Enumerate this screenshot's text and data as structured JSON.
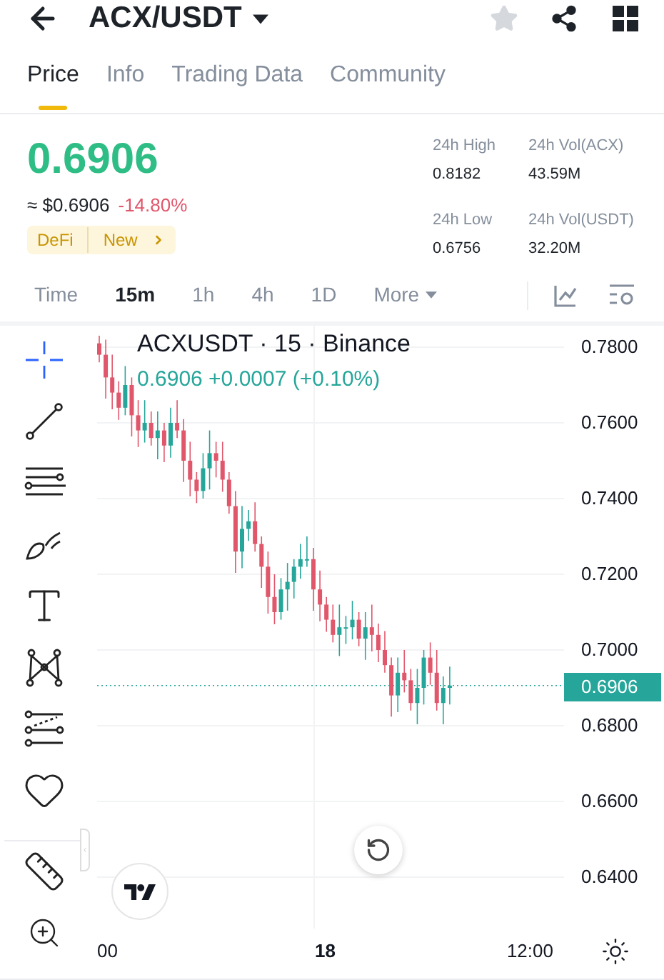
{
  "header": {
    "title": "ACX/USDT",
    "favorite": false
  },
  "tabs": [
    {
      "label": "Price",
      "selected": true
    },
    {
      "label": "Info",
      "selected": false
    },
    {
      "label": "Trading Data",
      "selected": false
    },
    {
      "label": "Community",
      "selected": false
    }
  ],
  "price": {
    "last": "0.6906",
    "usd": "≈ $0.6906",
    "change": "-14.80%",
    "tags": [
      "DeFi",
      "New"
    ]
  },
  "stats": [
    {
      "label": "24h High",
      "value": "0.8182"
    },
    {
      "label": "24h Vol(ACX)",
      "value": "43.59M"
    },
    {
      "label": "24h Low",
      "value": "0.6756"
    },
    {
      "label": "24h Vol(USDT)",
      "value": "32.20M"
    }
  ],
  "intervals": [
    {
      "label": "Time",
      "selected": false,
      "kind": "plain"
    },
    {
      "label": "15m",
      "selected": true,
      "kind": "plain"
    },
    {
      "label": "1h",
      "selected": false,
      "kind": "plain"
    },
    {
      "label": "4h",
      "selected": false,
      "kind": "plain"
    },
    {
      "label": "1D",
      "selected": false,
      "kind": "plain"
    },
    {
      "label": "More",
      "selected": false,
      "kind": "menu"
    }
  ],
  "tools": [
    {
      "kind": "crosshair",
      "selected": true
    },
    {
      "kind": "trendline",
      "selected": false
    },
    {
      "kind": "fib",
      "selected": false
    },
    {
      "kind": "brush",
      "selected": false
    },
    {
      "kind": "text",
      "selected": false
    },
    {
      "kind": "pattern",
      "selected": false
    },
    {
      "kind": "projection",
      "selected": false
    },
    {
      "kind": "favorites",
      "selected": false
    },
    {
      "kind": "ruler",
      "selected": false
    },
    {
      "kind": "zoom",
      "selected": false
    }
  ],
  "chart": {
    "legend": "ACXUSDT · 15 · Binance",
    "quote": "0.6906 +0.0007 (+0.10%)",
    "price_labels": [
      "0.7800",
      "0.7600",
      "0.7400",
      "0.7200",
      "0.7000",
      "0.6800",
      "0.6600",
      "0.6400"
    ],
    "last_price": "0.6906",
    "time_labels": [
      {
        "label": "00",
        "bold": false
      },
      {
        "label": "18",
        "bold": true
      },
      {
        "label": "12:00",
        "bold": false
      }
    ]
  }
}
